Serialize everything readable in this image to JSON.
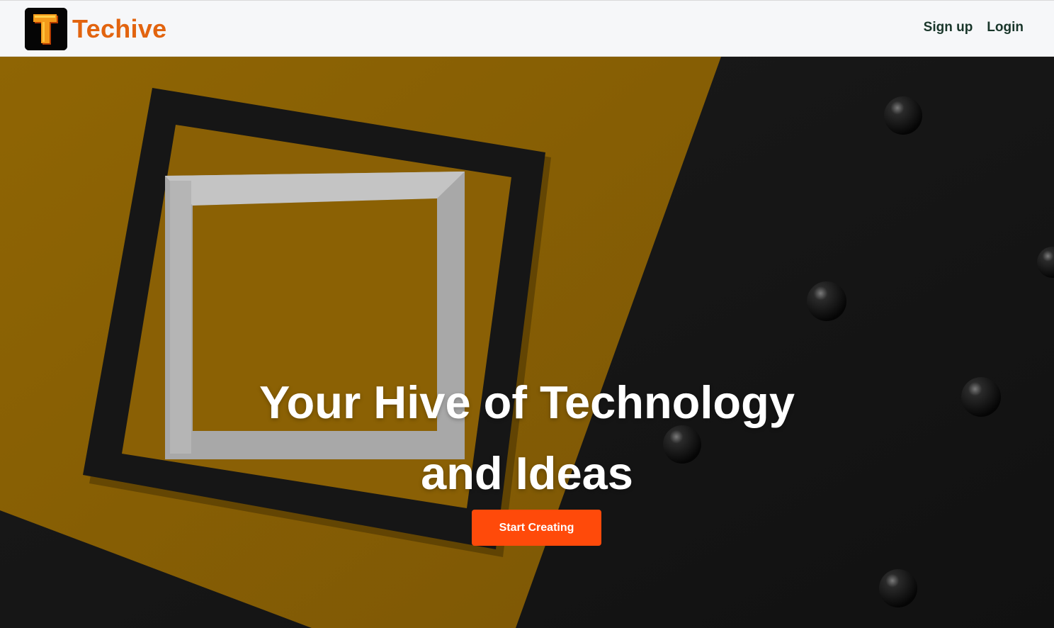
{
  "header": {
    "brand_name": "Techive",
    "logo_letter": "T",
    "nav": {
      "signup_label": "Sign up",
      "login_label": "Login"
    }
  },
  "hero": {
    "title_line1": "Your Hive of Technology",
    "title_line2": "and Ideas",
    "cta_label": "Start Creating",
    "background": "frames-on-yellow-and-black-photo"
  },
  "colors": {
    "brand_orange": "#e2640f",
    "nav_link": "#19362a",
    "cta_background": "#ff4a0a",
    "hero_yellow": "#8a6005",
    "hero_dark": "#161616"
  }
}
